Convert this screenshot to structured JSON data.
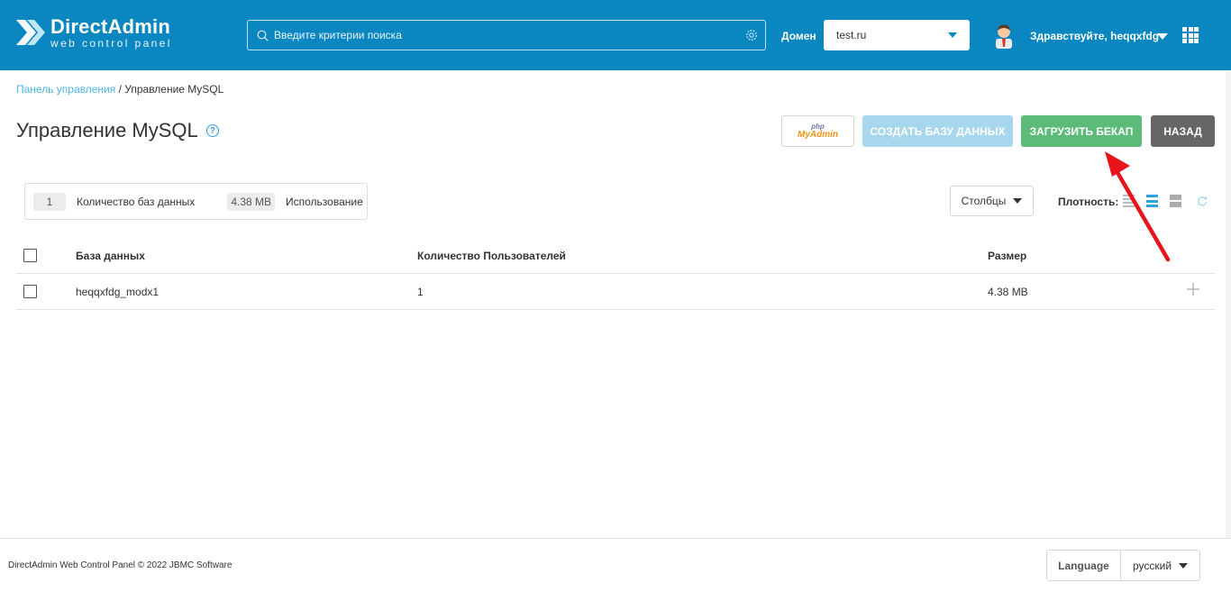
{
  "header": {
    "logo_name": "DirectAdmin",
    "logo_sub": "web control panel",
    "search_placeholder": "Введите критерии поиска",
    "domain_label": "Домен",
    "domain_value": "test.ru",
    "greeting": "Здравствуйте, heqqxfdg"
  },
  "breadcrumb": {
    "home": "Панель управления",
    "separator": " / ",
    "current": "Управление MySQL"
  },
  "page": {
    "title": "Управление MySQL",
    "help": "?"
  },
  "actions": {
    "pma_php": "php",
    "pma_my": "MyAdmin",
    "create": "СОЗДАТЬ БАЗУ ДАННЫХ",
    "upload": "ЗАГРУЗИТЬ БЕКАП",
    "back": "НАЗАД"
  },
  "stats": {
    "db_count": "1",
    "db_count_label": "Количество баз данных",
    "usage": "4.38 MB",
    "usage_label": "Использование"
  },
  "toolbar": {
    "columns": "Столбцы",
    "density_label": "Плотность:"
  },
  "table": {
    "headers": [
      "База данных",
      "Количество Пользователей",
      "Размер"
    ],
    "rows": [
      {
        "name": "heqqxfdg_modx1",
        "users": "1",
        "size": "4.38 MB"
      }
    ]
  },
  "footer": {
    "copyright": "DirectAdmin Web Control Panel © 2022 JBMC Software",
    "language_label": "Language",
    "language_value": "русский"
  },
  "colors": {
    "header": "#0a86c0",
    "create_button": "#a7d7ed",
    "upload_button": "#5cbb78",
    "back_button": "#666666",
    "annotation_arrow": "#e8141b"
  }
}
